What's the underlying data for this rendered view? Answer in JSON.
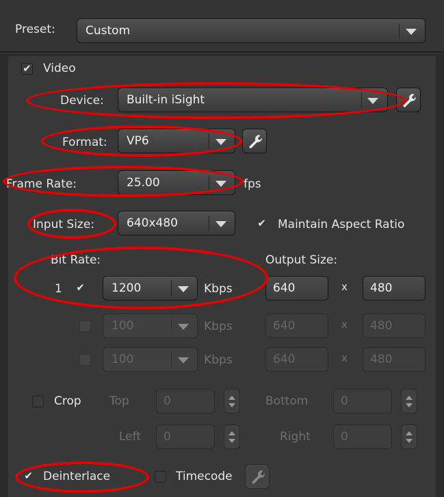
{
  "preset": {
    "label": "Preset:",
    "value": "Custom"
  },
  "video": {
    "label": "Video",
    "checked": true
  },
  "device": {
    "label": "Device:",
    "value": "Built-in iSight"
  },
  "format": {
    "label": "Format:",
    "value": "VP6"
  },
  "frame_rate": {
    "label": "Frame Rate:",
    "value": "25.00",
    "unit": "fps"
  },
  "input_size": {
    "label": "Input Size:",
    "value": "640x480"
  },
  "maintain_aspect": {
    "label": "Maintain Aspect Ratio",
    "checked": true
  },
  "bit_rate": {
    "label": "Bit Rate:"
  },
  "output_size": {
    "label": "Output Size:"
  },
  "streams": [
    {
      "index": "1",
      "enabled": true,
      "bitrate": "1200",
      "unit": "Kbps",
      "width": "640",
      "x": "x",
      "height": "480"
    },
    {
      "index": "",
      "enabled": false,
      "bitrate": "100",
      "unit": "Kbps",
      "width": "640",
      "x": "x",
      "height": "480"
    },
    {
      "index": "",
      "enabled": false,
      "bitrate": "100",
      "unit": "Kbps",
      "width": "640",
      "x": "x",
      "height": "480"
    }
  ],
  "crop": {
    "label": "Crop",
    "top_label": "Top",
    "top_value": "0",
    "bottom_label": "Bottom",
    "bottom_value": "0",
    "left_label": "Left",
    "left_value": "0",
    "right_label": "Right",
    "right_value": "0"
  },
  "deinterlace": {
    "label": "Deinterlace",
    "checked": true
  },
  "timecode": {
    "label": "Timecode",
    "checked": false
  },
  "colors": {
    "annotation_red": "#e60000",
    "panel_bg": "#383838"
  }
}
